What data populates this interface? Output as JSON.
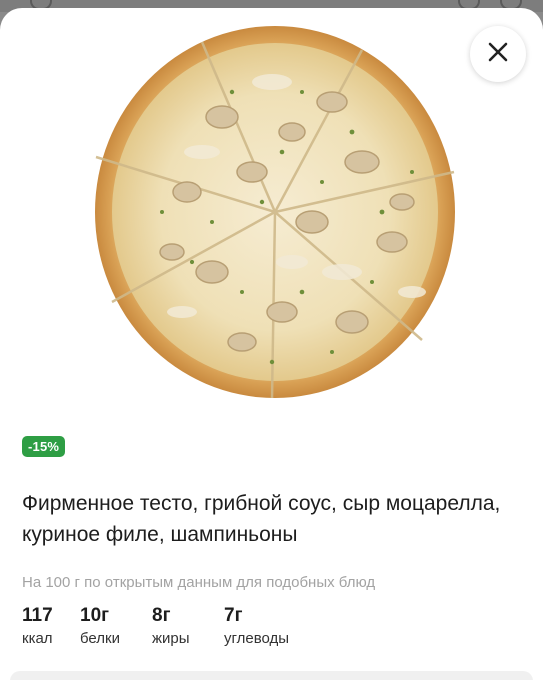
{
  "badge": {
    "discount": "-15%"
  },
  "description": "Фирменное тесто, грибной соус, сыр моцарелла, куриное филе, шампиньоны",
  "nutrition_note": "На 100 г по открытым данным для подобных блюд",
  "nutrients": [
    {
      "value": "117",
      "label": "ккал"
    },
    {
      "value": "10г",
      "label": "белки"
    },
    {
      "value": "8г",
      "label": "жиры"
    },
    {
      "value": "7г",
      "label": "углеводы"
    }
  ],
  "icons": {
    "close": "close-icon",
    "image": "pizza-image"
  },
  "colors": {
    "badge": "#2e9e44",
    "note": "#a3a3a3",
    "text": "#1d1d1d"
  }
}
